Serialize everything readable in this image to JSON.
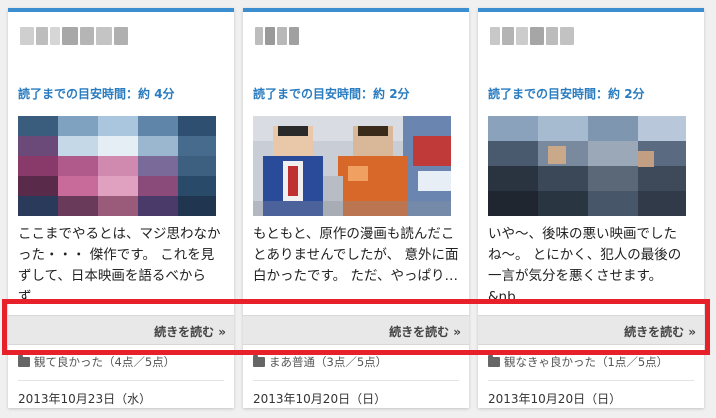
{
  "cards": [
    {
      "read_time_prefix": "読了までの目安時間：約",
      "read_time_value": "4分",
      "excerpt": "ここまでやるとは、マジ思わなかった・・・ 傑作です。 これを見ずして、日本映画を語るべからず…",
      "more_label": "続きを読む »",
      "category": "観て良かった（4点／5点）",
      "date": "2013年10月23日（水）"
    },
    {
      "read_time_prefix": "読了までの目安時間：約",
      "read_time_value": "2分",
      "excerpt": "もともと、原作の漫画も読んだことありませんでしたが、 意外に面白かったです。 ただ、やっぱり…",
      "more_label": "続きを読む »",
      "category": "まあ普通（3点／5点）",
      "date": "2013年10月20日（日）"
    },
    {
      "read_time_prefix": "読了までの目安時間：約",
      "read_time_value": "2分",
      "excerpt": "いや〜、後味の悪い映画でしたね〜。 とにかく、犯人の最後の一言が気分を悪くさせます。 &nb…",
      "more_label": "続きを読む »",
      "category": "観なきゃ良かった（1点／5点）",
      "date": "2013年10月20日（日）"
    }
  ],
  "colors": {
    "accent": "#3b8fd0",
    "read_time": "#2a7cc0",
    "highlight": "#e8202a"
  },
  "icons": {
    "category": "folder-icon",
    "more": "double-chevron-right"
  }
}
